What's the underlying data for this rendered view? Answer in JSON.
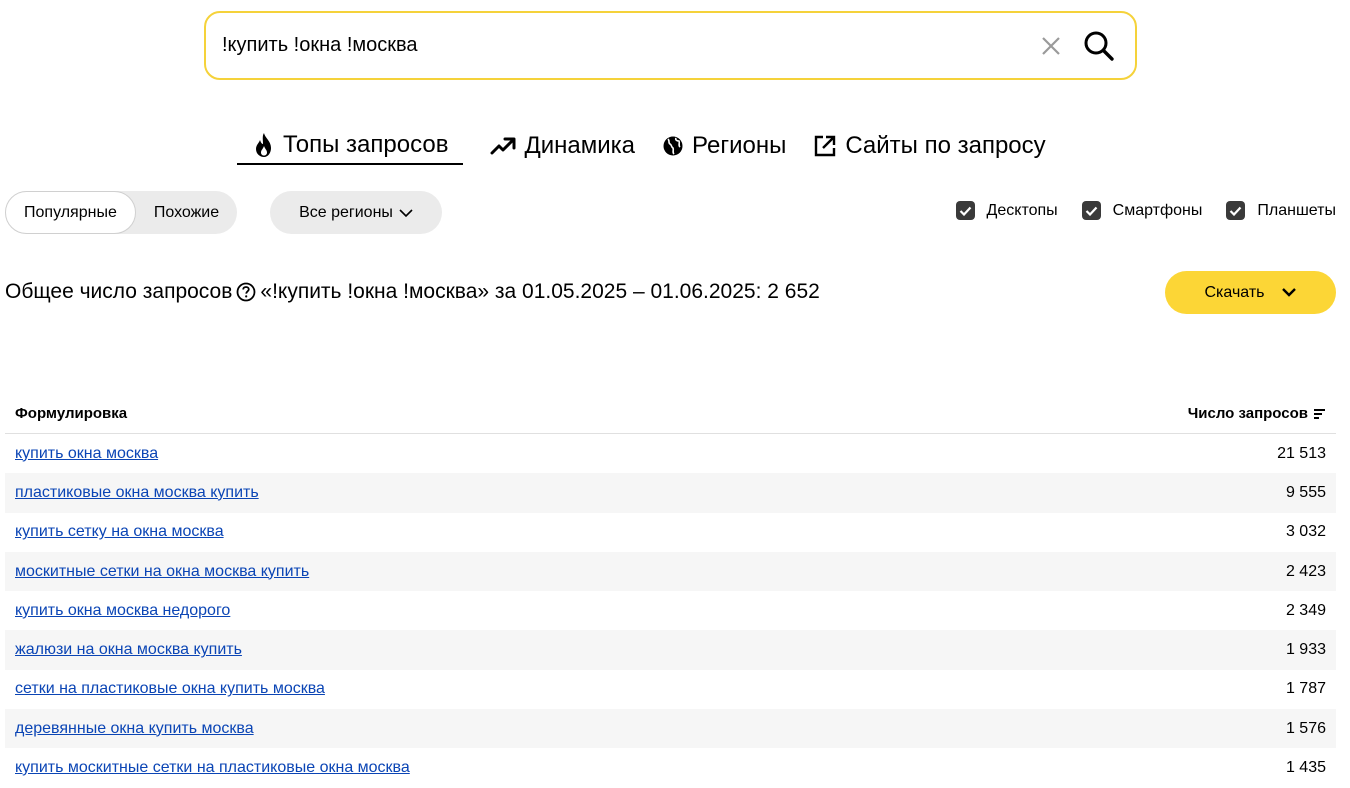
{
  "search": {
    "value": "!купить !окна !москва"
  },
  "tabs": [
    {
      "label": "Топы запросов",
      "icon": "fire-icon",
      "active": true
    },
    {
      "label": "Динамика",
      "icon": "trend-up-icon",
      "active": false
    },
    {
      "label": "Регионы",
      "icon": "globe-icon",
      "active": false
    },
    {
      "label": "Сайты по запросу",
      "icon": "external-link-icon",
      "active": false
    }
  ],
  "filters": {
    "mode_popular": "Популярные",
    "mode_similar": "Похожие",
    "region": "Все регионы",
    "devices": [
      {
        "label": "Десктопы",
        "checked": true
      },
      {
        "label": "Смартфоны",
        "checked": true
      },
      {
        "label": "Планшеты",
        "checked": true
      }
    ]
  },
  "summary": {
    "prefix": "Общее число запросов",
    "text": "«!купить !окна !москва» за 01.05.2025 – 01.06.2025: 2 652",
    "download": "Скачать"
  },
  "table": {
    "col_phrase": "Формулировка",
    "col_count": "Число запросов",
    "rows": [
      {
        "phrase": "купить окна москва",
        "count": "21 513"
      },
      {
        "phrase": "пластиковые окна москва купить",
        "count": "9 555"
      },
      {
        "phrase": "купить сетку на окна москва",
        "count": "3 032"
      },
      {
        "phrase": "москитные сетки на окна москва купить",
        "count": "2 423"
      },
      {
        "phrase": "купить окна москва недорого",
        "count": "2 349"
      },
      {
        "phrase": "жалюзи на окна москва купить",
        "count": "1 933"
      },
      {
        "phrase": "сетки на пластиковые окна купить москва",
        "count": "1 787"
      },
      {
        "phrase": "деревянные окна купить москва",
        "count": "1 576"
      },
      {
        "phrase": "купить москитные сетки на пластиковые окна москва",
        "count": "1 435"
      }
    ]
  },
  "colors": {
    "accent_yellow": "#fcd636",
    "search_border": "#f5d23a",
    "link": "#0b45b5"
  }
}
